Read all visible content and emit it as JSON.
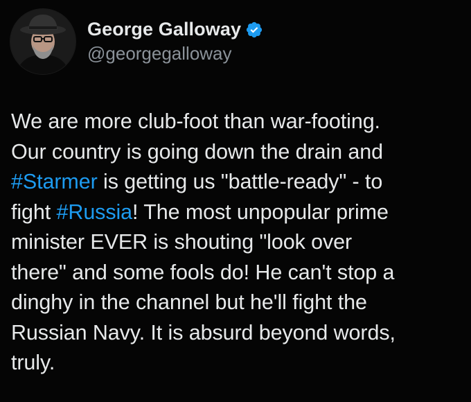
{
  "author": {
    "display_name": "George Galloway",
    "handle": "@georgegalloway",
    "verified": true,
    "avatar_icon": "profile-photo"
  },
  "colors": {
    "background": "#000000",
    "text": "#e7e9ea",
    "handle": "#8b9299",
    "hashtag": "#1d9bf0",
    "verified_badge": "#1d9bf0"
  },
  "tweet": {
    "lines": [
      [
        {
          "text": "We are more club-foot than war-footing."
        }
      ],
      [
        {
          "text": "Our country is going down the drain and"
        }
      ],
      [
        {
          "text": "#Starmer",
          "hashtag": true
        },
        {
          "text": " is getting us \"battle-ready\" - to"
        }
      ],
      [
        {
          "text": "fight "
        },
        {
          "text": "#Russia",
          "hashtag": true
        },
        {
          "text": "! The most unpopular prime"
        }
      ],
      [
        {
          "text": "minister EVER is shouting \"look over"
        }
      ],
      [
        {
          "text": "there\" and some fools do! He can't stop a"
        }
      ],
      [
        {
          "text": "dinghy in the channel but he'll fight the"
        }
      ],
      [
        {
          "text": "Russian Navy. It is absurd beyond words,"
        }
      ],
      [
        {
          "text": "truly."
        }
      ]
    ]
  }
}
